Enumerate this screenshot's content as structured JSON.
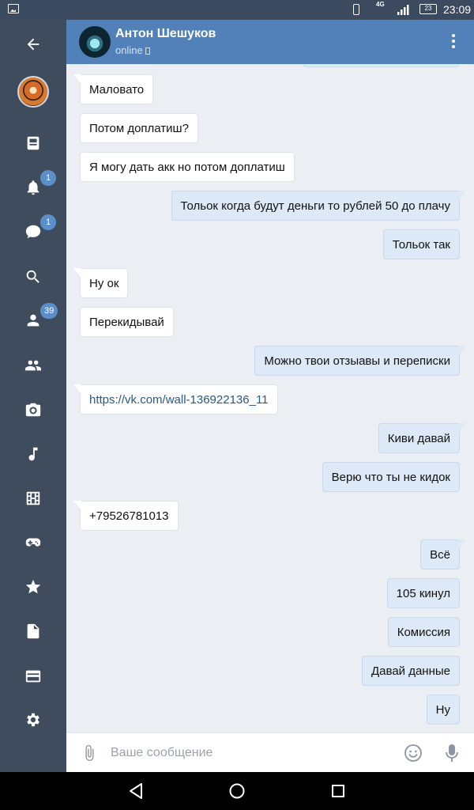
{
  "status_bar": {
    "network": "4G",
    "battery": "23",
    "time": "23:09"
  },
  "sidebar": {
    "items": [
      {
        "name": "back-arrow-icon",
        "badge": null
      },
      {
        "name": "profile-avatar",
        "badge": null
      },
      {
        "name": "news-icon",
        "badge": null
      },
      {
        "name": "notifications-bell-icon",
        "badge": "1"
      },
      {
        "name": "messages-icon",
        "badge": "1"
      },
      {
        "name": "search-icon",
        "badge": null
      },
      {
        "name": "friends-icon",
        "badge": "39"
      },
      {
        "name": "communities-icon",
        "badge": null
      },
      {
        "name": "photos-camera-icon",
        "badge": null
      },
      {
        "name": "music-note-icon",
        "badge": null
      },
      {
        "name": "videos-film-icon",
        "badge": null
      },
      {
        "name": "games-gamepad-icon",
        "badge": null
      },
      {
        "name": "favorites-star-icon",
        "badge": null
      },
      {
        "name": "documents-icon",
        "badge": null
      },
      {
        "name": "payments-card-icon",
        "badge": null
      },
      {
        "name": "settings-gear-icon",
        "badge": null
      }
    ]
  },
  "header": {
    "name": "Антон Шешуков",
    "status": "online"
  },
  "messages": [
    {
      "dir": "in",
      "text": "Маловато"
    },
    {
      "dir": "in",
      "text": "Потом доплатиш?"
    },
    {
      "dir": "in",
      "text": "Я могу дать акк но потом доплатиш"
    },
    {
      "dir": "out",
      "text": "Тольок когда будут деньги то рублей 50 до плачу"
    },
    {
      "dir": "out",
      "text": "Тольок так"
    },
    {
      "dir": "in",
      "text": "Ну ок"
    },
    {
      "dir": "in",
      "text": "Перекидывай"
    },
    {
      "dir": "out",
      "text": "Можно твои отзыавы и переписки"
    },
    {
      "dir": "in",
      "text": "https://vk.com/wall-136922136_11"
    },
    {
      "dir": "out",
      "text": "Киви давай"
    },
    {
      "dir": "out",
      "text": "Верю что ты не кидок"
    },
    {
      "dir": "in",
      "text": "+79526781013"
    },
    {
      "dir": "out",
      "text": "Всё"
    },
    {
      "dir": "out",
      "text": "105 кинул"
    },
    {
      "dir": "out",
      "text": "Комиссия"
    },
    {
      "dir": "out",
      "text": "Давай данные"
    },
    {
      "dir": "out",
      "text": "Ну"
    }
  ],
  "input": {
    "placeholder": "Ваше сообщение",
    "value": ""
  },
  "colors": {
    "header": "#5181b8",
    "sidebar": "#3f4c5e",
    "chat_bg": "#ebeff4",
    "out_bubble": "#dde9f7",
    "in_bubble": "#ffffff",
    "badge": "#5b8fc9",
    "link": "#2a5885"
  }
}
